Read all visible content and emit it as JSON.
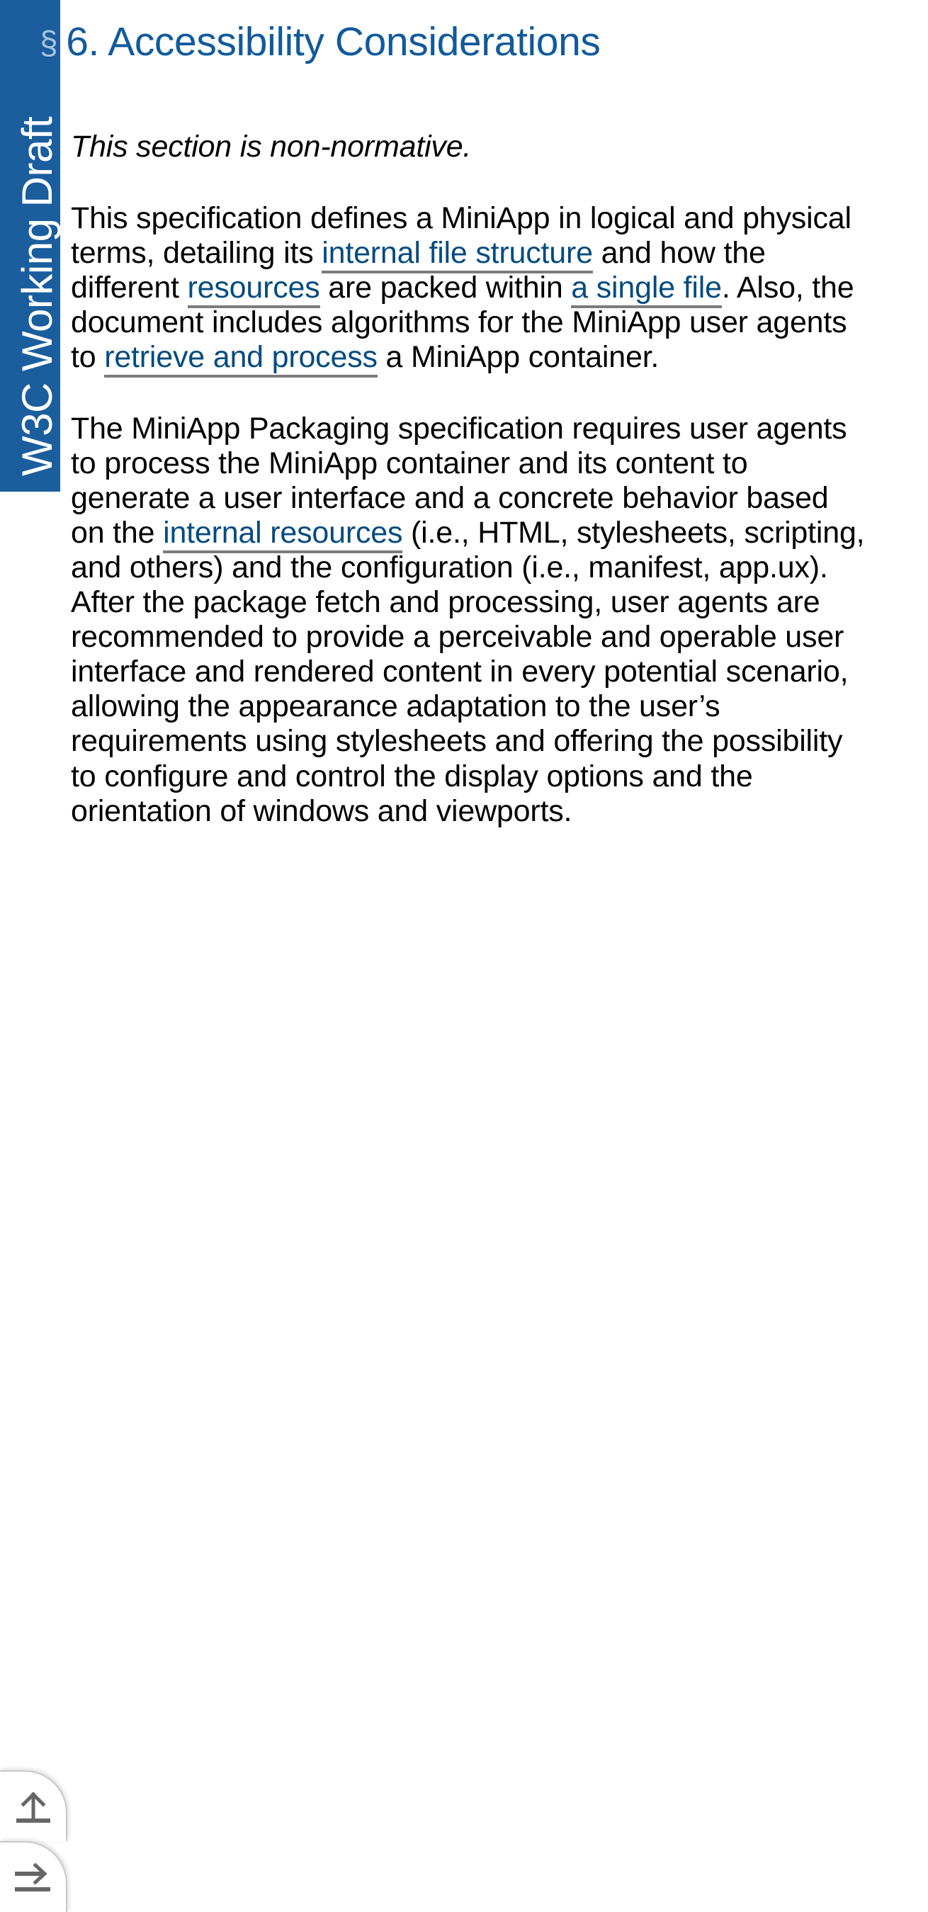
{
  "status_banner": {
    "label": "W3C Working Draft",
    "background_color": "#1b5e9e",
    "text_color": "#ffffff"
  },
  "heading": {
    "self_link_glyph": "§",
    "self_link_name": "section-sign-icon",
    "number": "6.",
    "title": "6. Accessibility Considerations",
    "color": "#115a9c",
    "self_link_color": "#a8c4dc"
  },
  "paragraphs": {
    "non_normative": "This section is non-normative.",
    "intro": {
      "seg1": "This specification defines a MiniApp in logical and physical terms, detailing its ",
      "link1": "internal file structure",
      "seg2": " and how the different ",
      "link2": "resources",
      "seg3": " are packed within ",
      "link3": "a single file",
      "seg4": ". Also, the document includes algorithms for the MiniApp user agents to ",
      "link4": "retrieve and process",
      "seg5": " a MiniApp container."
    },
    "packaging": {
      "seg1": "The MiniApp Packaging specification requires user agents to process the MiniApp container and its content to generate a user interface and a concrete behavior based on the ",
      "link1": "internal resources",
      "seg2": " (i.e., HTML, stylesheets, scripting, and others) and the configuration (i.e., manifest, app.ux). After the package fetch and processing, user agents are recommended to provide a perceivable and operable user interface and rendered content in every potential scenario, allowing the appearance adaptation to the user’s requirements using stylesheets and offering the possibility to configure and control the display options and the orientation of windows and viewports."
    }
  },
  "link_style": {
    "color": "#044b7f",
    "underline_color": "#7c7c7c"
  },
  "float_nav": {
    "back_to_top": {
      "icon": "arrow-up-to-line-icon",
      "label": "Back to top"
    },
    "next_section": {
      "icon": "arrow-right-to-line-icon",
      "label": "Next section"
    },
    "icon_color": "#666666"
  }
}
